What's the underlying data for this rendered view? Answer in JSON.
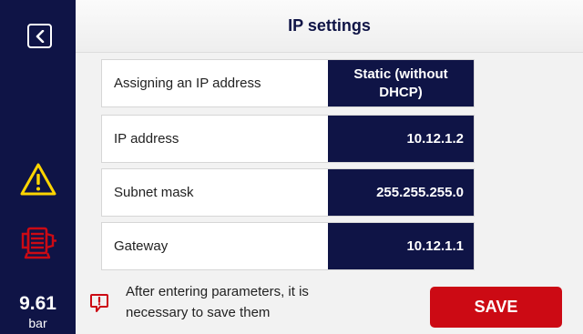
{
  "title": "IP settings",
  "status": {
    "pressure_value": "9.61",
    "pressure_unit": "bar"
  },
  "icons": {
    "back": "back-arrow-icon",
    "warning": "warning-triangle-icon",
    "motor": "motor-icon",
    "notice": "exclamation-bubble-icon"
  },
  "settings": {
    "assign": {
      "label": "Assigning an IP address",
      "value": "Static (without DHCP)"
    },
    "ip": {
      "label": "IP address",
      "value": "10.12.1.2"
    },
    "mask": {
      "label": "Subnet mask",
      "value": "255.255.255.0"
    },
    "gateway": {
      "label": "Gateway",
      "value": "10.12.1.1"
    }
  },
  "notice": "After entering parameters, it is necessary to save them",
  "save_label": "SAVE",
  "colors": {
    "sidebar": "#0f1446",
    "value_box": "#0f1446",
    "warning": "#ffd500",
    "alarm_red": "#cc0a14",
    "save_button": "#cc0a14"
  }
}
